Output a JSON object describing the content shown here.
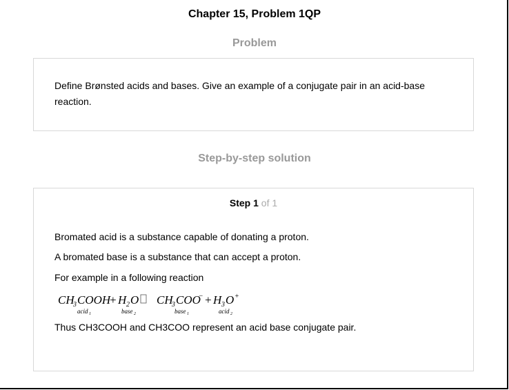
{
  "header": {
    "title": "Chapter 15, Problem 1QP"
  },
  "problem": {
    "heading": "Problem",
    "text": "Define Brønsted acids and bases. Give an example of a conjugate pair in an acid-base reaction."
  },
  "solution": {
    "heading": "Step-by-step solution",
    "step_label": "Step",
    "step_number": "1",
    "step_total": "of 1",
    "lines": [
      "Bromated acid is a substance capable of donating a proton.",
      "A bromated base is a substance that can accept a proton.",
      "For example in a following reaction"
    ],
    "equation": {
      "reactant1": "CH",
      "reactant1_sub": "3",
      "reactant1_tail": "COOH",
      "plus1": "+",
      "reactant2": "H",
      "reactant2_sub": "2",
      "reactant2_tail": "O",
      "product1": "CH",
      "product1_sub": "3",
      "product1_tail": "COO",
      "product1_sup": "−",
      "plus2": "+",
      "product2": "H",
      "product2_sub": "3",
      "product2_tail": "O",
      "product2_sup": "+",
      "label_acid1": "acid",
      "label_acid1_sub": "1",
      "label_base2": "base",
      "label_base2_sub": "2",
      "label_base1": "base",
      "label_base1_sub": "1",
      "label_acid2": "acid",
      "label_acid2_sub": "2"
    },
    "conclusion": "Thus CH3COOH and CH3COO represent an acid base conjugate pair."
  }
}
